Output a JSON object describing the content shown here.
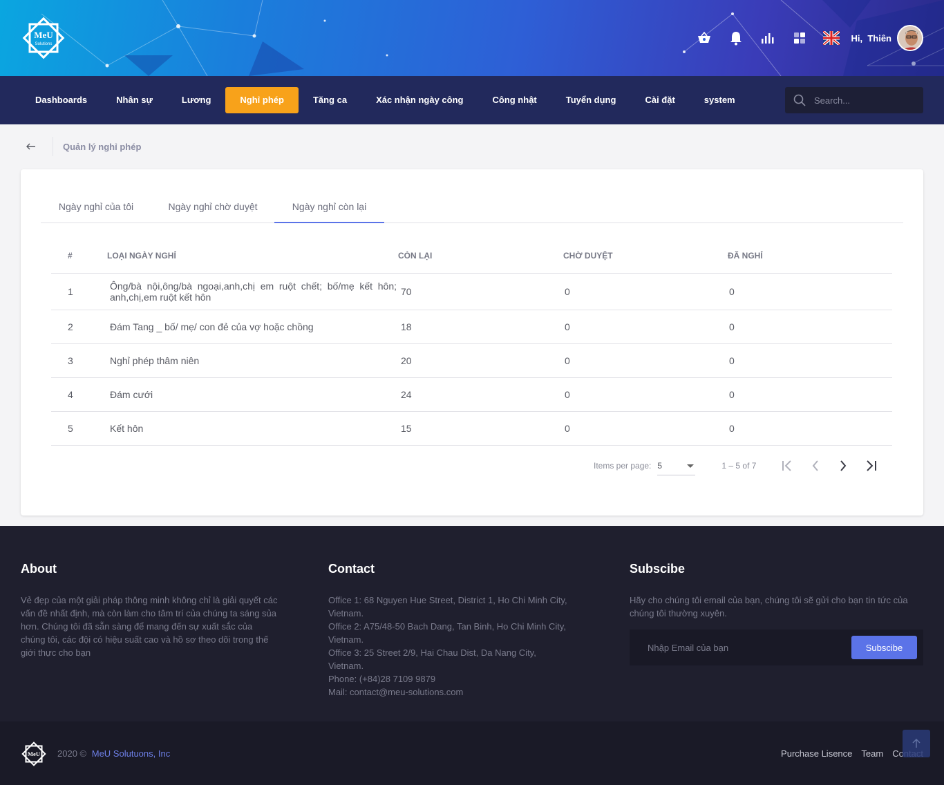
{
  "header": {
    "greeting": "Hi,",
    "user_name": "Thiên",
    "icons": [
      "basket-icon",
      "bell-icon",
      "chart-icon",
      "apps-icon",
      "uk-flag-icon"
    ]
  },
  "logo": {
    "text": "MeU",
    "subtext": "Solutions"
  },
  "nav": {
    "items": [
      {
        "label": "Dashboards"
      },
      {
        "label": "Nhân sự"
      },
      {
        "label": "Lương"
      },
      {
        "label": "Nghỉ phép",
        "active": true
      },
      {
        "label": "Tăng ca"
      },
      {
        "label": "Xác nhận ngày công"
      },
      {
        "label": "Công nhật"
      },
      {
        "label": "Tuyển dụng"
      },
      {
        "label": "Cài đặt"
      },
      {
        "label": "system"
      }
    ],
    "search_placeholder": "Search...",
    "active_color": "#f8a21a"
  },
  "breadcrumb": {
    "title": "Quản lý nghỉ phép"
  },
  "tabs": [
    {
      "label": "Ngày nghỉ của tôi"
    },
    {
      "label": "Ngày nghỉ chờ duyệt"
    },
    {
      "label": "Ngày nghỉ còn lại",
      "active": true
    }
  ],
  "table": {
    "headers": [
      "#",
      "LOẠI NGÀY NGHỈ",
      "CÒN LẠI",
      "CHỜ DUYỆT",
      "ĐÃ NGHỈ"
    ],
    "rows": [
      [
        "1",
        "Ông/bà nội,ông/bà ngoại,anh,chị em ruột chết; bố/mẹ kết hôn; anh,chị,em ruột kết hôn",
        "70",
        "0",
        "0"
      ],
      [
        "2",
        "Đám Tang _ bố/ mẹ/ con đẻ của vợ hoặc chồng",
        "18",
        "0",
        "0"
      ],
      [
        "3",
        "Nghỉ phép thâm niên",
        "20",
        "0",
        "0"
      ],
      [
        "4",
        "Đám cưới",
        "24",
        "0",
        "0"
      ],
      [
        "5",
        "Kết hôn",
        "15",
        "0",
        "0"
      ]
    ]
  },
  "paginator": {
    "items_per_page_label": "Items per page:",
    "page_size": "5",
    "range": "1 – 5 of 7"
  },
  "footer": {
    "about_title": "About",
    "about_text": "Vẻ đẹp của một giải pháp thông minh không chỉ là giải quyết các vấn đề nhất định, mà còn làm cho tâm trí của chúng ta sáng sủa hơn. Chúng tôi đã sẵn sàng để mang đến sự xuất sắc của chúng tôi, các đội có hiệu suất cao và hồ sơ theo dõi trong thế giới thực cho bạn",
    "contact_title": "Contact",
    "contact_lines": [
      "Office 1: 68 Nguyen Hue Street, District 1, Ho Chi Minh City, Vietnam.",
      "Office 2: A75/48-50 Bach Dang, Tan Binh, Ho Chi Minh City, Vietnam.",
      "Office 3: 25 Street 2/9, Hai Chau Dist, Da Nang City, Vietnam.",
      "Phone: (+84)28 7109 9879",
      "Mail: contact@meu-solutions.com"
    ],
    "subscribe_title": "Subscibe",
    "subscribe_text": "Hãy cho chúng tôi email của bạn, chúng tôi sẽ gửi cho bạn tin tức của chúng tôi thường xuyên.",
    "email_placeholder": "Nhập Email của bạn",
    "subscribe_button": "Subscibe"
  },
  "bottom": {
    "copyright": "2020 ©",
    "brand": "MeU Solutuons, Inc",
    "links": [
      "Purchase Lisence",
      "Team",
      "Contact"
    ]
  }
}
